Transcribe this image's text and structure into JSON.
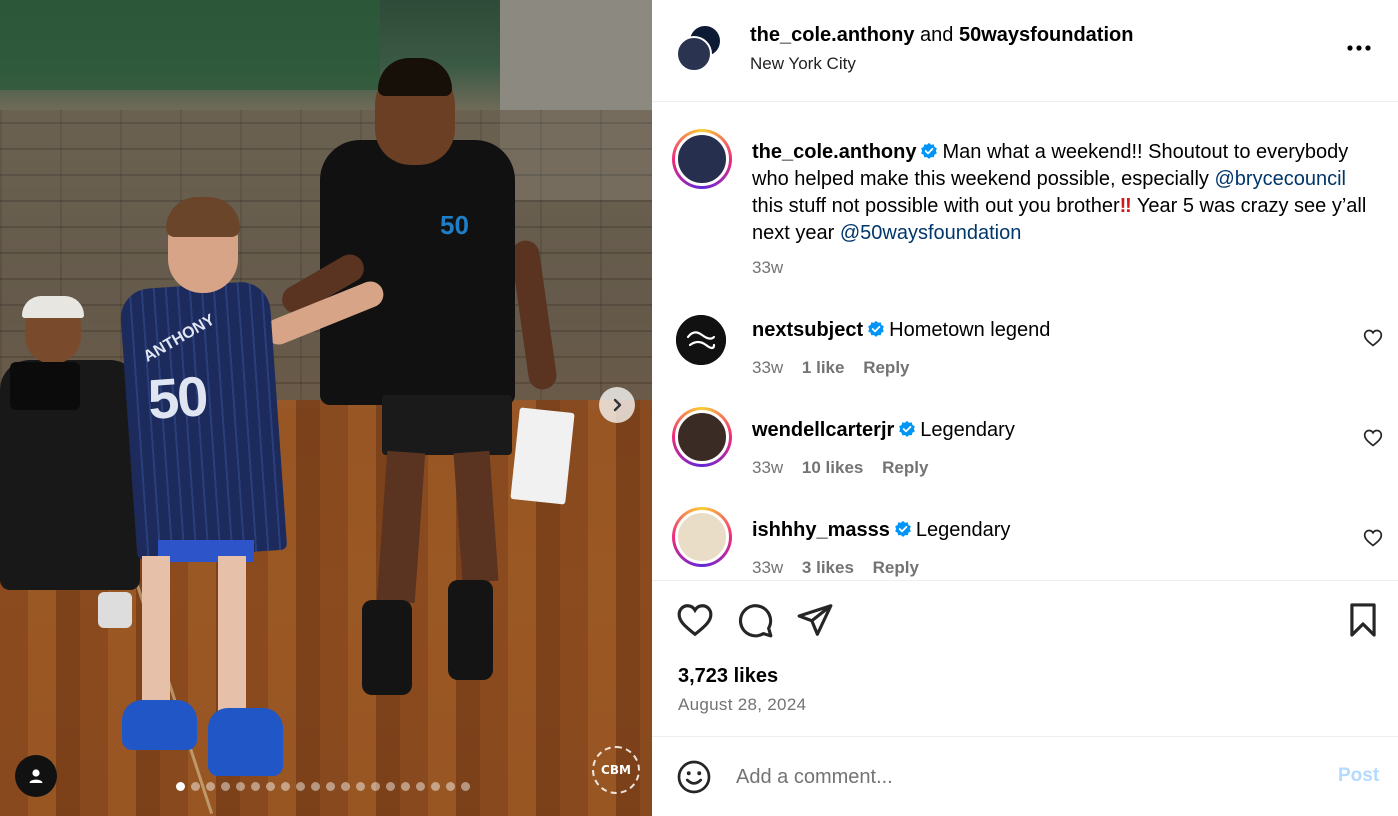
{
  "media": {
    "watermark_text": "CBM",
    "carousel": {
      "total_slides": 20,
      "current_slide": 1
    }
  },
  "header": {
    "author": "the_cole.anthony",
    "joiner": "and",
    "coauthor": "50waysfoundation",
    "location": "New York City"
  },
  "caption": {
    "username": "the_cole.anthony",
    "text_part1": "Man what a weekend!! Shoutout to everybody who helped make this weekend possible, especially ",
    "mention1": "@brycecouncil",
    "text_part2": " this stuff not possible with out you brother",
    "emoji": "‼",
    "text_part3": " Year 5 was crazy see y’all next year ",
    "mention2": "@50waysfoundation",
    "time": "33w"
  },
  "comments": [
    {
      "username": "nextsubject",
      "text": "Hometown legend",
      "time": "33w",
      "likes": "1 like",
      "reply": "Reply"
    },
    {
      "username": "wendellcarterjr",
      "text": "Legendary",
      "time": "33w",
      "likes": "10 likes",
      "reply": "Reply"
    },
    {
      "username": "ishhhy_masss",
      "text": "Legendary",
      "time": "33w",
      "likes": "3 likes",
      "reply": "Reply"
    }
  ],
  "stats": {
    "likes": "3,723 likes",
    "date": "August 28, 2024"
  },
  "composer": {
    "placeholder": "Add a comment...",
    "post_label": "Post"
  },
  "colors": {
    "link": "#00376b",
    "verified": "#0095f6",
    "muted": "#737373",
    "post_disabled": "#b3dbff"
  }
}
